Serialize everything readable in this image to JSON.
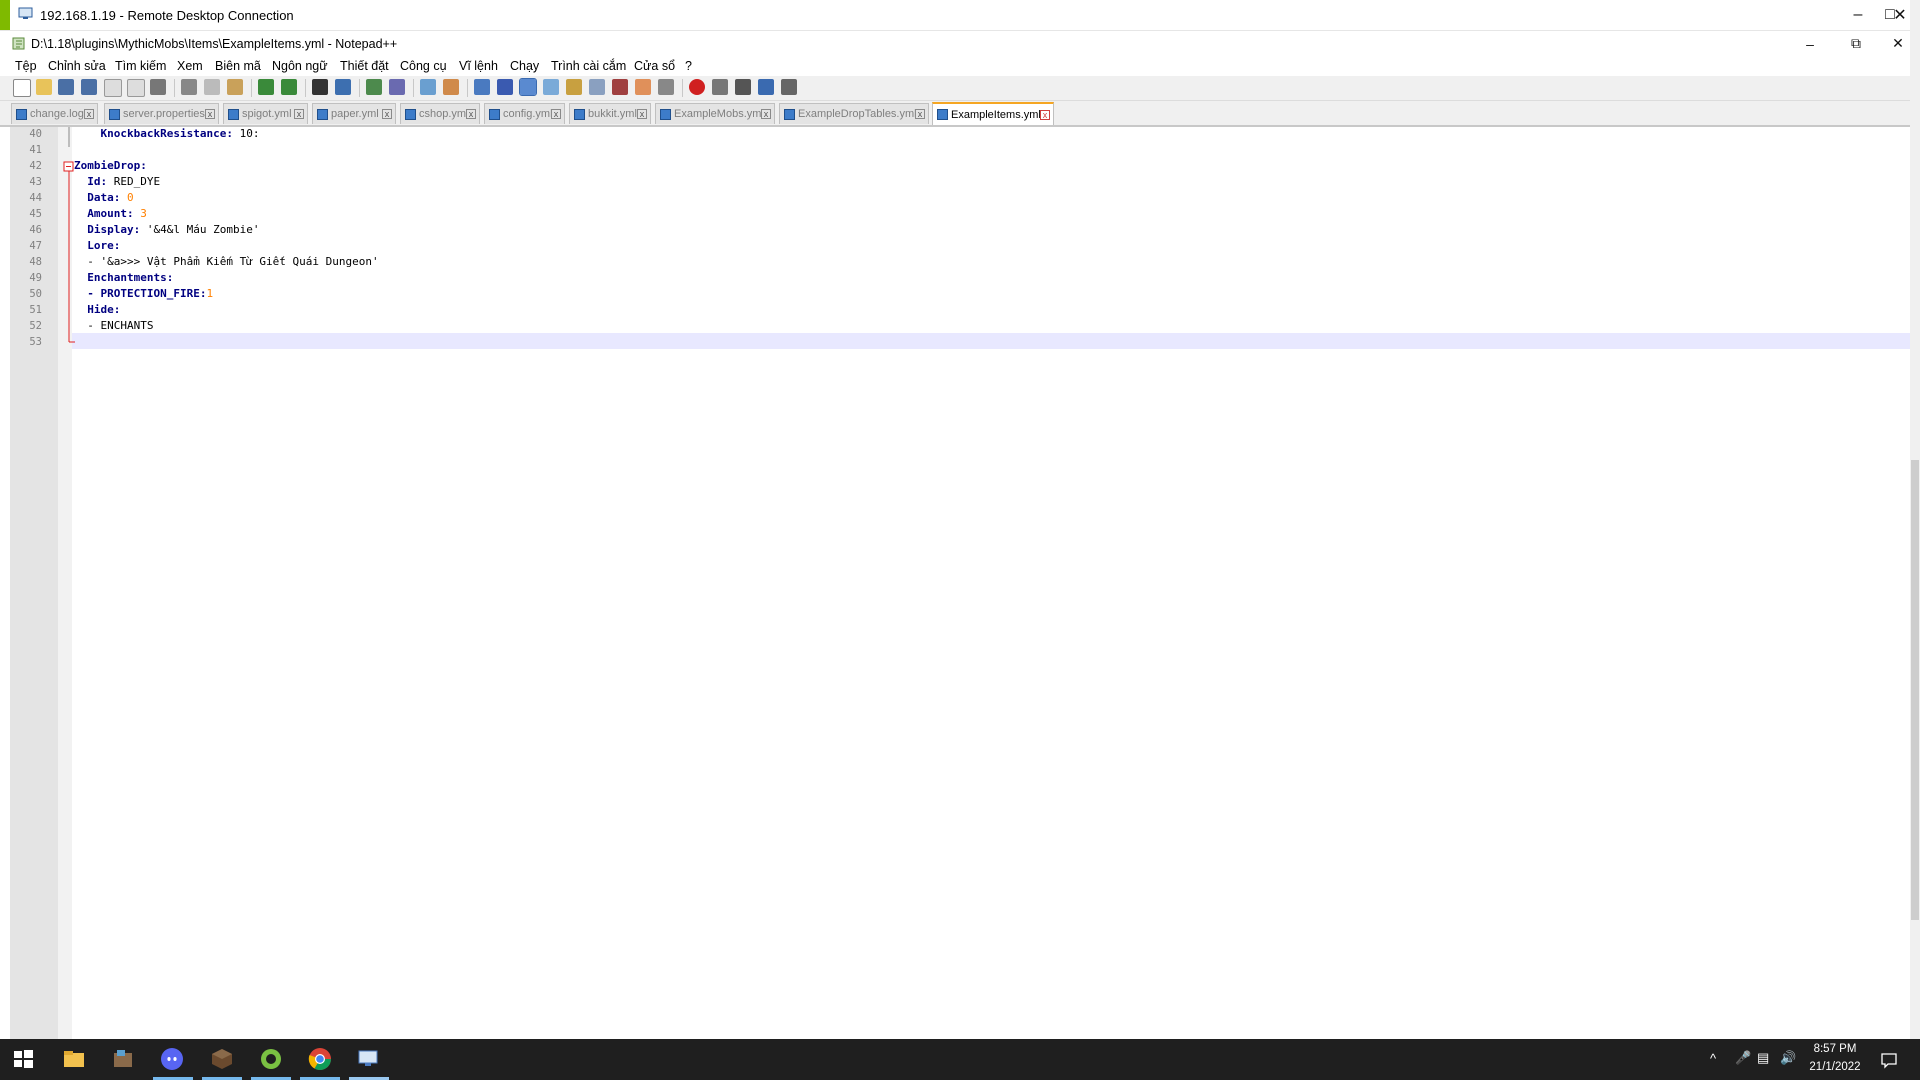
{
  "rdp": {
    "title": "192.168.1.19 - Remote Desktop Connection"
  },
  "npp": {
    "title": "D:\\1.18\\plugins\\MythicMobs\\Items\\ExampleItems.yml - Notepad++",
    "menu": [
      "Tệp",
      "Chỉnh sửa",
      "Tìm kiếm",
      "Xem",
      "Biên mã",
      "Ngôn ngữ",
      "Thiết đặt",
      "Công cụ",
      "Vĩ lệnh",
      "Chạy",
      "Trình cài cắm",
      "Cửa sổ",
      "?"
    ],
    "tabs": [
      "change.log",
      "server.properties",
      "spigot.yml",
      "paper.yml",
      "cshop.yml",
      "config.yml",
      "bukkit.yml",
      "ExampleMobs.yml",
      "ExampleDropTables.yml",
      "ExampleItems.yml"
    ],
    "active_tab": "ExampleItems.yml",
    "lines": [
      {
        "no": "40",
        "key": "    KnockbackResistance:",
        "val": " 10:",
        "valtype": "plain"
      },
      {
        "no": "41",
        "key": "",
        "val": "",
        "valtype": "plain"
      },
      {
        "no": "42",
        "key": "ZombieDrop:",
        "val": "",
        "valtype": "plain"
      },
      {
        "no": "43",
        "key": "  Id:",
        "val": " RED_DYE",
        "valtype": "plain"
      },
      {
        "no": "44",
        "key": "  Data:",
        "val": " 0",
        "valtype": "num"
      },
      {
        "no": "45",
        "key": "  Amount:",
        "val": " 3",
        "valtype": "num"
      },
      {
        "no": "46",
        "key": "  Display:",
        "val": " '&4&l Máu Zombie'",
        "valtype": "plain"
      },
      {
        "no": "47",
        "key": "  Lore:",
        "val": "",
        "valtype": "plain"
      },
      {
        "no": "48",
        "key": "",
        "val": "  - '&a>>> Vật Phẩm Kiếm Từ Giết Quái Dungeon'",
        "valtype": "plain"
      },
      {
        "no": "49",
        "key": "  Enchantments:",
        "val": "",
        "valtype": "plain"
      },
      {
        "no": "50",
        "key": "  - PROTECTION_FIRE:",
        "val": "1",
        "valtype": "num"
      },
      {
        "no": "51",
        "key": "  Hide:",
        "val": "",
        "valtype": "plain"
      },
      {
        "no": "52",
        "key": "",
        "val": "  - ENCHANTS",
        "valtype": "plain"
      },
      {
        "no": "53",
        "key": "",
        "val": "",
        "valtype": "plain"
      }
    ]
  },
  "taskbar": {
    "time": "8:57 PM",
    "date": "21/1/2022",
    "apps": [
      "start-icon",
      "file-explorer-icon",
      "minecraft-server-icon",
      "discord-icon",
      "minecraft-icon",
      "app-icon",
      "chrome-icon",
      "remote-desktop-icon"
    ]
  },
  "colors": {
    "accent": "#7fba00",
    "tab_active": "#f5a623",
    "keyword": "#000080",
    "number": "#ff8000"
  }
}
